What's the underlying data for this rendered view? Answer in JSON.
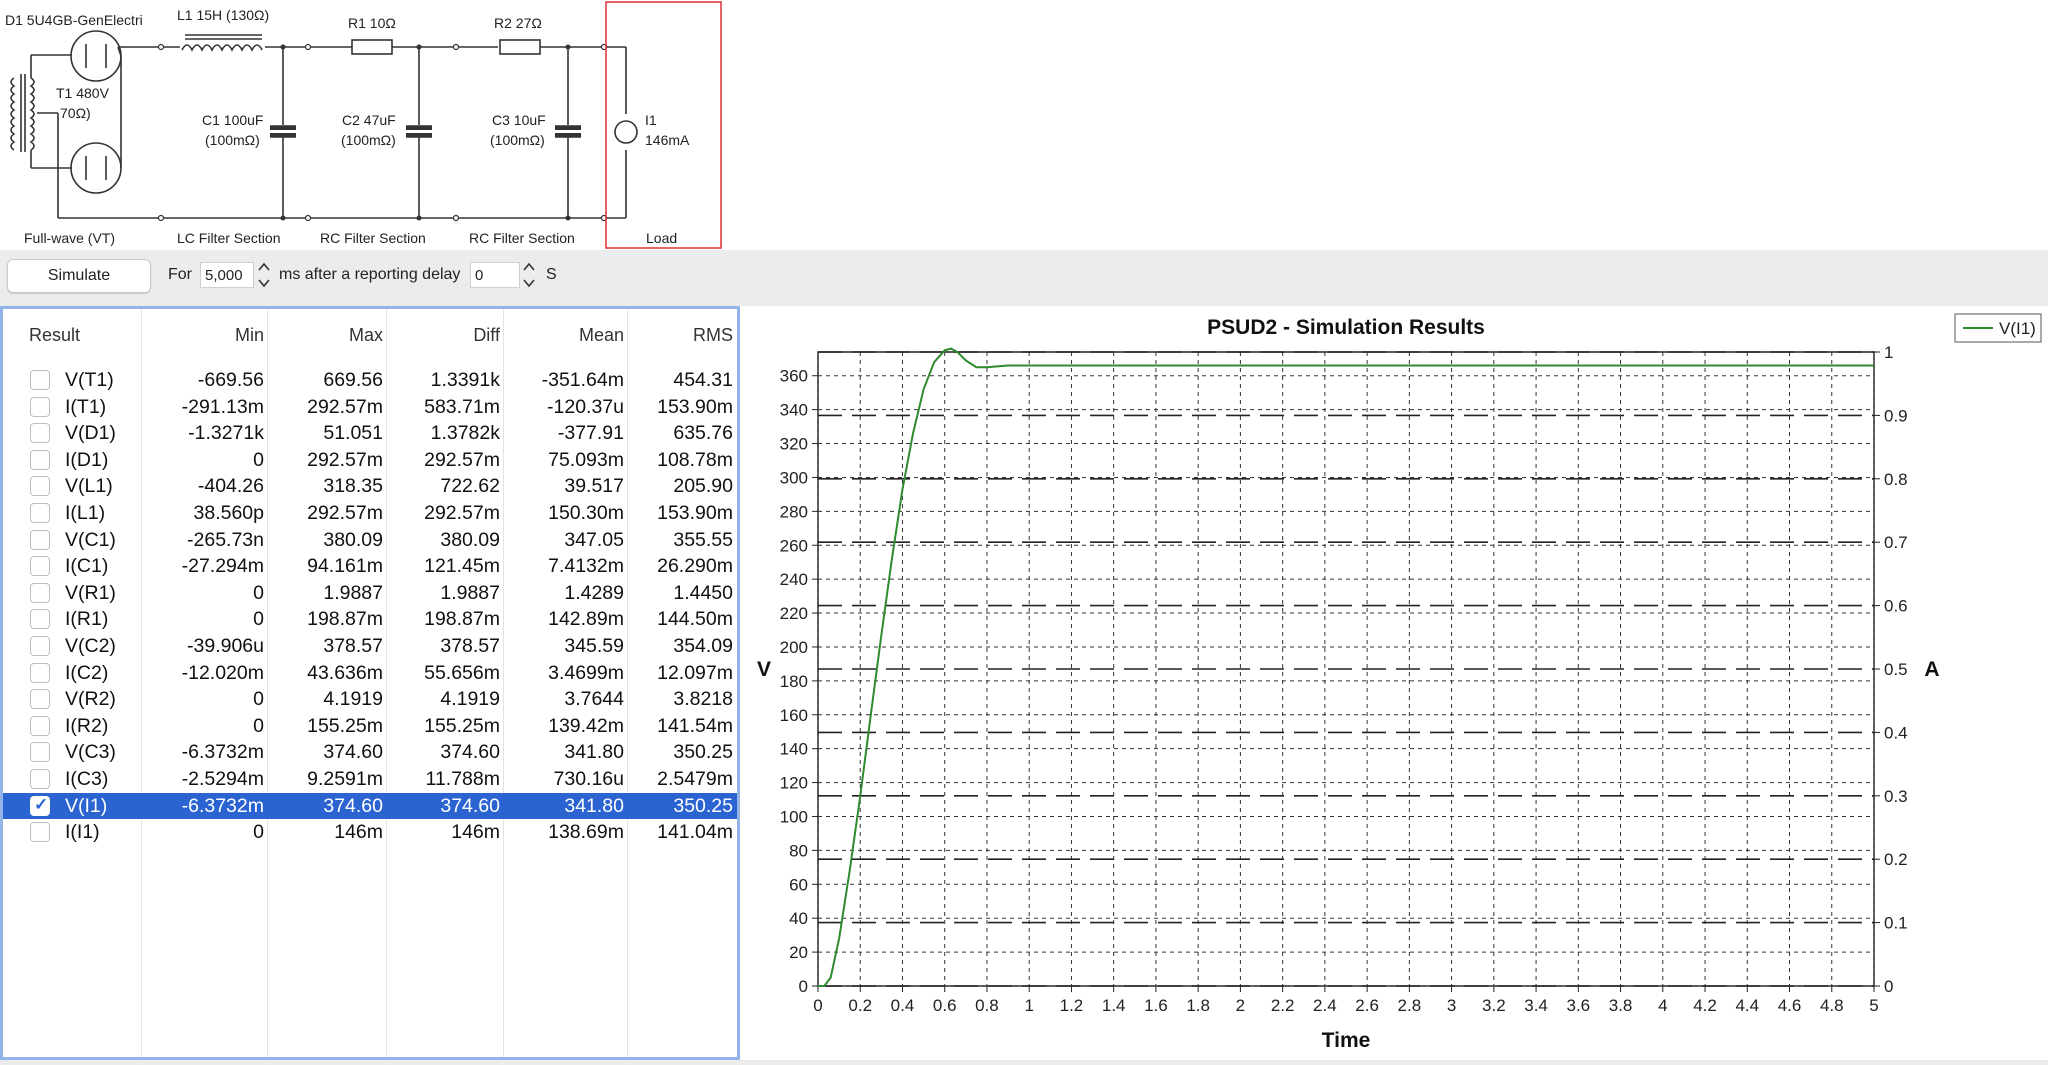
{
  "schematic": {
    "rectifier_label": "D1 5U4GB-GenElectri",
    "transformer_label": "T1 480V",
    "transformer_res": "70Ω)",
    "inductor_label": "L1 15H (130Ω)",
    "r1_label": "R1 10Ω",
    "r2_label": "R2 27Ω",
    "c1_label": "C1 100uF",
    "c1_esr": "(100mΩ)",
    "c2_label": "C2 47uF",
    "c2_esr": "(100mΩ)",
    "c3_label": "C3 10uF",
    "c3_esr": "(100mΩ)",
    "load_label": "I1",
    "load_value": "146mA",
    "sections": [
      "Full-wave (VT)",
      "LC Filter Section",
      "RC Filter Section",
      "RC Filter Section",
      "Load"
    ]
  },
  "toolbar": {
    "simulate_label": "Simulate",
    "for_label": "For",
    "duration_value": "5,000",
    "after_label": "ms after a reporting delay",
    "delay_value": "0",
    "delay_unit": "S"
  },
  "results": {
    "headers": [
      "Result",
      "Min",
      "Max",
      "Diff",
      "Mean",
      "RMS"
    ],
    "rows": [
      {
        "name": "V(T1)",
        "min": "-669.56",
        "max": "669.56",
        "diff": "1.3391k",
        "mean": "-351.64m",
        "rms": "454.31",
        "checked": false
      },
      {
        "name": "I(T1)",
        "min": "-291.13m",
        "max": "292.57m",
        "diff": "583.71m",
        "mean": "-120.37u",
        "rms": "153.90m",
        "checked": false
      },
      {
        "name": "V(D1)",
        "min": "-1.3271k",
        "max": "51.051",
        "diff": "1.3782k",
        "mean": "-377.91",
        "rms": "635.76",
        "checked": false
      },
      {
        "name": "I(D1)",
        "min": "0",
        "max": "292.57m",
        "diff": "292.57m",
        "mean": "75.093m",
        "rms": "108.78m",
        "checked": false
      },
      {
        "name": "V(L1)",
        "min": "-404.26",
        "max": "318.35",
        "diff": "722.62",
        "mean": "39.517",
        "rms": "205.90",
        "checked": false
      },
      {
        "name": "I(L1)",
        "min": "38.560p",
        "max": "292.57m",
        "diff": "292.57m",
        "mean": "150.30m",
        "rms": "153.90m",
        "checked": false
      },
      {
        "name": "V(C1)",
        "min": "-265.73n",
        "max": "380.09",
        "diff": "380.09",
        "mean": "347.05",
        "rms": "355.55",
        "checked": false
      },
      {
        "name": "I(C1)",
        "min": "-27.294m",
        "max": "94.161m",
        "diff": "121.45m",
        "mean": "7.4132m",
        "rms": "26.290m",
        "checked": false
      },
      {
        "name": "V(R1)",
        "min": "0",
        "max": "1.9887",
        "diff": "1.9887",
        "mean": "1.4289",
        "rms": "1.4450",
        "checked": false
      },
      {
        "name": "I(R1)",
        "min": "0",
        "max": "198.87m",
        "diff": "198.87m",
        "mean": "142.89m",
        "rms": "144.50m",
        "checked": false
      },
      {
        "name": "V(C2)",
        "min": "-39.906u",
        "max": "378.57",
        "diff": "378.57",
        "mean": "345.59",
        "rms": "354.09",
        "checked": false
      },
      {
        "name": "I(C2)",
        "min": "-12.020m",
        "max": "43.636m",
        "diff": "55.656m",
        "mean": "3.4699m",
        "rms": "12.097m",
        "checked": false
      },
      {
        "name": "V(R2)",
        "min": "0",
        "max": "4.1919",
        "diff": "4.1919",
        "mean": "3.7644",
        "rms": "3.8218",
        "checked": false
      },
      {
        "name": "I(R2)",
        "min": "0",
        "max": "155.25m",
        "diff": "155.25m",
        "mean": "139.42m",
        "rms": "141.54m",
        "checked": false
      },
      {
        "name": "V(C3)",
        "min": "-6.3732m",
        "max": "374.60",
        "diff": "374.60",
        "mean": "341.80",
        "rms": "350.25",
        "checked": false
      },
      {
        "name": "I(C3)",
        "min": "-2.5294m",
        "max": "9.2591m",
        "diff": "11.788m",
        "mean": "730.16u",
        "rms": "2.5479m",
        "checked": false
      },
      {
        "name": "V(I1)",
        "min": "-6.3732m",
        "max": "374.60",
        "diff": "374.60",
        "mean": "341.80",
        "rms": "350.25",
        "checked": true
      },
      {
        "name": "I(I1)",
        "min": "0",
        "max": "146m",
        "diff": "146m",
        "mean": "138.69m",
        "rms": "141.04m",
        "checked": false
      }
    ]
  },
  "chart_data": {
    "type": "line",
    "title": "PSUD2 - Simulation Results",
    "xlabel": "Time",
    "ylabel": "V",
    "y2label": "A",
    "xlim": [
      0,
      5
    ],
    "ylim": [
      0,
      374
    ],
    "y2lim": [
      0,
      1
    ],
    "xticks": [
      "0",
      "0.2",
      "0.4",
      "0.6",
      "0.8",
      "1",
      "1.2",
      "1.4",
      "1.6",
      "1.8",
      "2",
      "2.2",
      "2.4",
      "2.6",
      "2.8",
      "3",
      "3.2",
      "3.4",
      "3.6",
      "3.8",
      "4",
      "4.2",
      "4.4",
      "4.6",
      "4.8",
      "5"
    ],
    "yticks": [
      "0",
      "20",
      "40",
      "60",
      "80",
      "100",
      "120",
      "140",
      "160",
      "180",
      "200",
      "220",
      "240",
      "260",
      "280",
      "300",
      "320",
      "340",
      "360"
    ],
    "y2ticks": [
      "0",
      "0.1",
      "0.2",
      "0.3",
      "0.4",
      "0.5",
      "0.6",
      "0.7",
      "0.8",
      "0.9",
      "1"
    ],
    "grid": true,
    "legend_position": "top-right",
    "series": [
      {
        "name": "V(I1)",
        "color": "#2e8b2e",
        "x": [
          0,
          0.03,
          0.06,
          0.1,
          0.15,
          0.2,
          0.25,
          0.3,
          0.35,
          0.4,
          0.45,
          0.5,
          0.55,
          0.6,
          0.63,
          0.66,
          0.7,
          0.75,
          0.8,
          0.9,
          1,
          1.5,
          2,
          3,
          4,
          5
        ],
        "y": [
          0,
          0,
          5,
          28,
          68,
          112,
          160,
          207,
          252,
          293,
          326,
          352,
          368,
          375,
          376,
          374,
          369,
          365,
          365,
          366,
          366,
          366,
          366,
          366,
          366,
          366
        ]
      }
    ]
  }
}
